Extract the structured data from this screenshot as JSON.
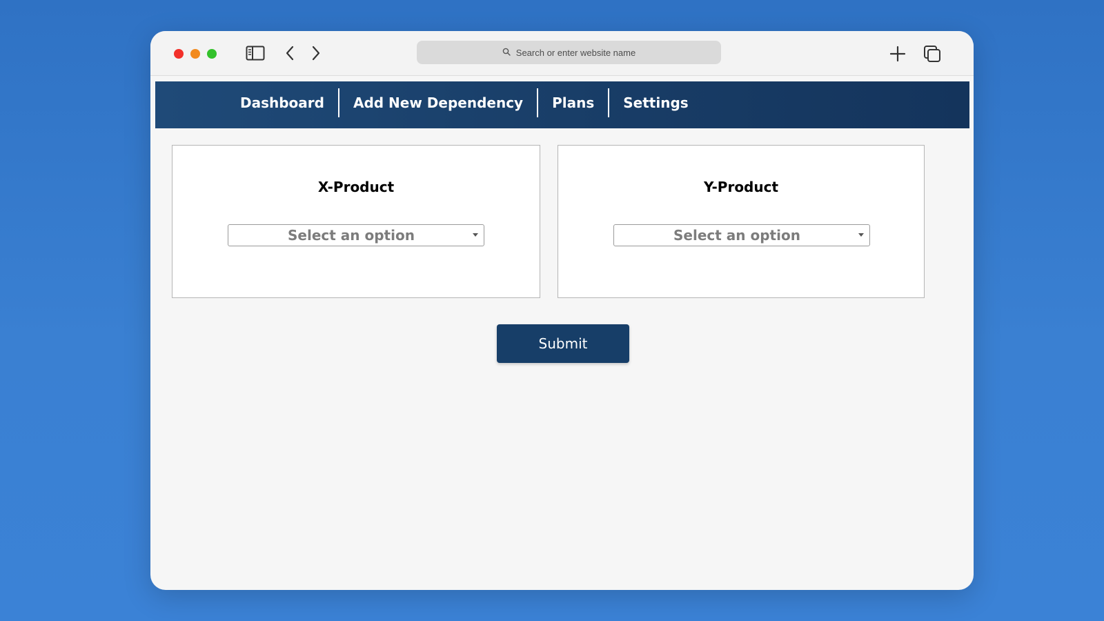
{
  "browser": {
    "address_placeholder": "Search or enter website name",
    "icons": {
      "sidebar": "sidebar-icon",
      "back": "chevron-left-icon",
      "forward": "chevron-right-icon",
      "search": "search-icon",
      "new_tab": "plus-icon",
      "tabs": "tabs-overview-icon"
    }
  },
  "nav": {
    "items": [
      {
        "label": "Dashboard"
      },
      {
        "label": "Add New Dependency"
      },
      {
        "label": "Plans"
      },
      {
        "label": "Settings"
      }
    ]
  },
  "form": {
    "x_product": {
      "title": "X-Product",
      "select_value": "Select an option"
    },
    "y_product": {
      "title": "Y-Product",
      "select_value": "Select an option"
    },
    "submit_label": "Submit"
  },
  "colors": {
    "nav_bg": "#193e68",
    "submit_bg": "#173e68",
    "page_bg": "#3078c8"
  }
}
